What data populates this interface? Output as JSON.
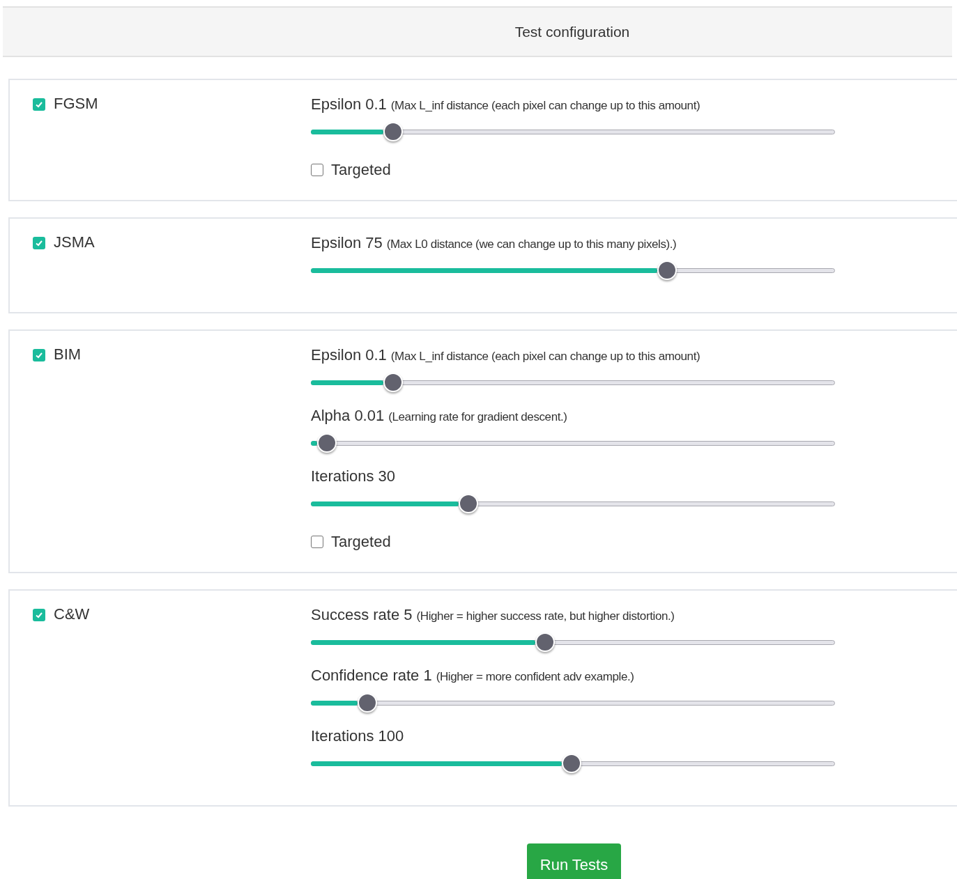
{
  "header": {
    "title": "Test configuration"
  },
  "attacks": [
    {
      "name": "FGSM",
      "checked": true,
      "params": [
        {
          "label": "Epsilon 0.1",
          "note": "(Max L_inf distance (each pixel can change up to this amount)",
          "level": 0.157
        }
      ],
      "targeted": {
        "label": "Targeted",
        "checked": false
      }
    },
    {
      "name": "JSMA",
      "checked": true,
      "params": [
        {
          "label": "Epsilon 75",
          "note": "(Max L0 distance (we can change up to this many pixels).)",
          "level": 0.68
        }
      ]
    },
    {
      "name": "BIM",
      "checked": true,
      "params": [
        {
          "label": "Epsilon 0.1",
          "note": "(Max L_inf distance (each pixel can change up to this amount)",
          "level": 0.157
        },
        {
          "label": "Alpha 0.01",
          "note": "(Learning rate for gradient descent.)",
          "level": 0.03
        },
        {
          "label": "Iterations 30",
          "level": 0.3
        }
      ],
      "targeted": {
        "label": "Targeted",
        "checked": false
      }
    },
    {
      "name": "C&W",
      "checked": true,
      "params": [
        {
          "label": "Success rate 5",
          "note": "(Higher = higher success rate, but higher distortion.)",
          "level": 0.447
        },
        {
          "label": "Confidence rate 1",
          "note": "(Higher = more confident adv example.)",
          "level": 0.108
        },
        {
          "label": "Iterations 100",
          "level": 0.497
        }
      ]
    }
  ],
  "run_button": {
    "label": "Run Tests"
  }
}
